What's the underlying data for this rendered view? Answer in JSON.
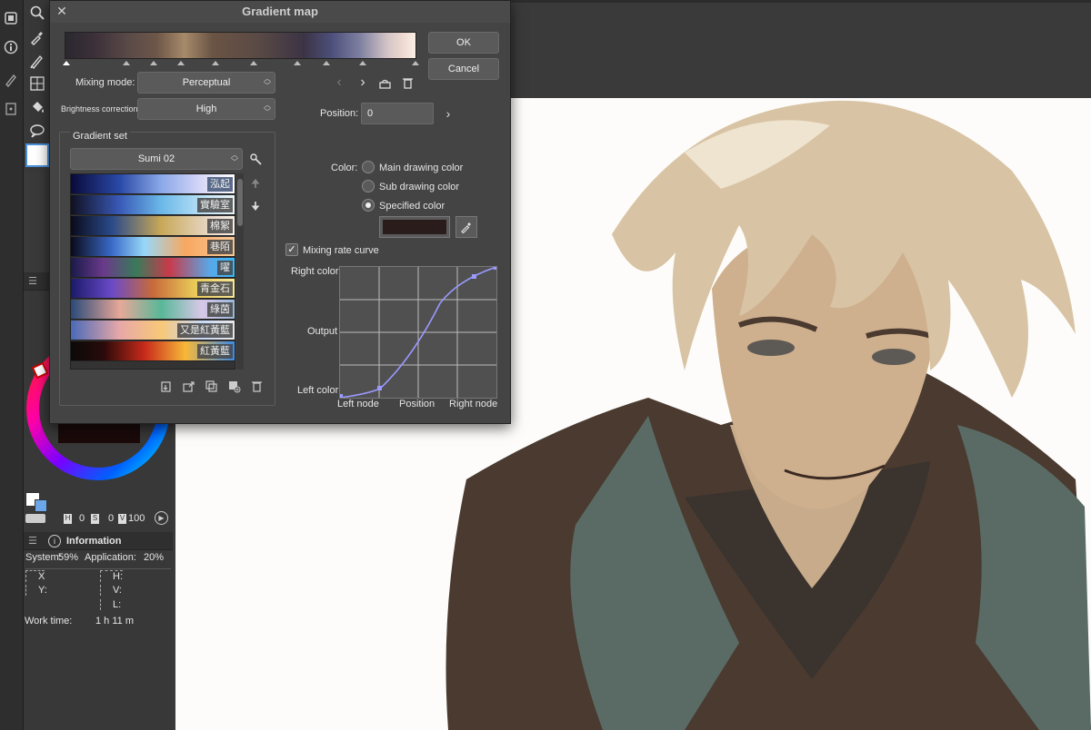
{
  "dialog": {
    "title": "Gradient map",
    "ok_label": "OK",
    "cancel_label": "Cancel",
    "mixing_mode_label": "Mixing mode:",
    "mixing_mode_value": "Perceptual",
    "brightness_label": "Brightness correction:",
    "brightness_value": "High",
    "position_label": "Position:",
    "position_value": "0",
    "gradient_set_label": "Gradient set",
    "gradient_set_value": "Sumi 02",
    "color_label": "Color:",
    "color_options": [
      "Main drawing color",
      "Sub drawing color",
      "Specified color"
    ],
    "selected_color_option": "Specified color",
    "specified_color": "#2a1c1a",
    "mixing_rate_label": "Mixing rate curve",
    "mixing_rate_checked": true,
    "curve": {
      "right_color_label": "Right color",
      "output_label": "Output",
      "left_color_label": "Left color",
      "left_node_label": "Left node",
      "position_axis_label": "Position",
      "right_node_label": "Right node"
    },
    "gradient_list": [
      {
        "name": "泓起"
      },
      {
        "name": "實驗室"
      },
      {
        "name": "棉絮"
      },
      {
        "name": "巷陌"
      },
      {
        "name": "嚁"
      },
      {
        "name": "青金石"
      },
      {
        "name": "綠茵"
      },
      {
        "name": "又是紅黃藍"
      },
      {
        "name": "紅黃藍"
      }
    ]
  },
  "color_panel": {
    "h_label": "H",
    "h_value": "0",
    "s_label": "S",
    "s_value": "0",
    "v_label": "V",
    "v_value": "100"
  },
  "info_panel": {
    "title": "Information",
    "system_label": "System:",
    "system_value": "59%",
    "application_label": "Application:",
    "application_value": "20%",
    "x_label": "X",
    "y_label": "Y:",
    "h_label": "H:",
    "v_label": "V:",
    "l_label": "L:",
    "work_time_label": "Work time:",
    "work_time_value": "1 h 11 m"
  }
}
